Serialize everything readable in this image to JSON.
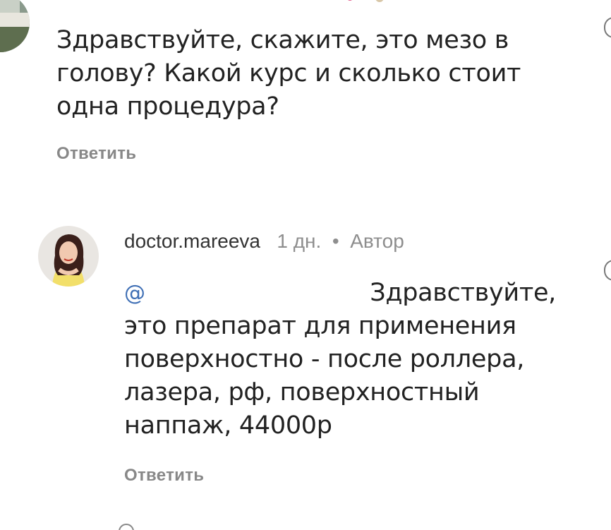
{
  "comment1": {
    "text": "Здравствуйте, скажите, это мезо в голову? Какой курс и сколько стоит одна процедура?",
    "reply_label": "Ответить"
  },
  "comment2": {
    "username": "doctor.mareeva",
    "time": "1 дн.",
    "separator": "•",
    "author_badge": "Автор",
    "mention_prefix": "@",
    "text_lines": [
      "Здравствуйте,",
      "это препарат для применения",
      "поверхностно - после роллера,",
      "лазера, рф, поверхностный",
      "наппаж, 44000р"
    ],
    "reply_label": "Ответить"
  },
  "colors": {
    "text": "#222222",
    "muted": "#8e8e8e",
    "reply": "#888888",
    "mention": "#3f6fb5"
  },
  "icons": [
    "avatar-top",
    "avatar-author"
  ]
}
